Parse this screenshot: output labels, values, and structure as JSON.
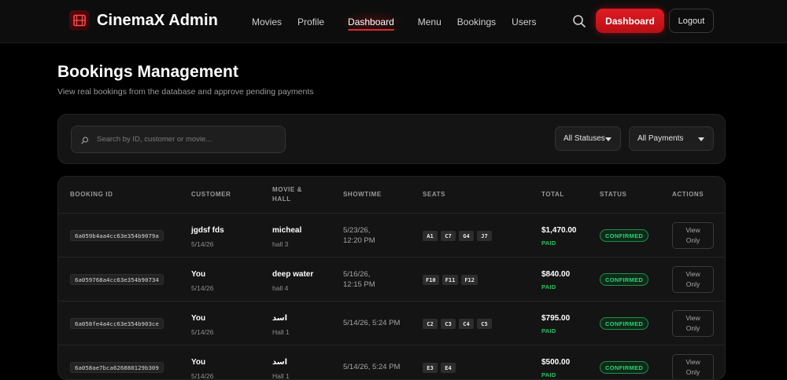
{
  "nav": {
    "brand": "CinemaX Admin",
    "links": [
      "Movies",
      "Profile",
      "Dashboard",
      "Menu",
      "Bookings",
      "Users"
    ],
    "active_link": "Dashboard",
    "dashboard_button": "Dashboard",
    "logout_button": "Logout"
  },
  "colors": {
    "accent": "#e01b22",
    "paid": "#22c55e",
    "confirmed": "#2fd072",
    "background": "#000000"
  },
  "header": {
    "title": "Bookings Management",
    "subtitle": "View real bookings from the database and approve pending payments"
  },
  "filters": {
    "search_placeholder": "Search by ID, customer or movie...",
    "status_selected": "All Statuses",
    "payment_selected": "All Payments"
  },
  "table": {
    "headers": {
      "booking_id": "BOOKING ID",
      "customer": "CUSTOMER",
      "movie_hall_1": "MOVIE &",
      "movie_hall_2": "HALL",
      "showtime": "SHOWTIME",
      "seats": "SEATS",
      "total": "TOTAL",
      "status": "STATUS",
      "actions": "ACTIONS"
    },
    "rows": [
      {
        "id": "6a059b4aa4cc63e354b9079a",
        "customer": "jgdsf fds",
        "customer_date": "5/14/26",
        "movie": "micheal",
        "hall": "hall 3",
        "showtime_1": "5/23/26,",
        "showtime_2": "12:20 PM",
        "seats": [
          "A1",
          "C7",
          "G4",
          "J7"
        ],
        "total": "$1,470.00",
        "payment": "PAID",
        "status": "CONFIRMED",
        "action_1": "View",
        "action_2": "Only"
      },
      {
        "id": "6a059768a4cc63e354b90734",
        "customer": "You",
        "customer_date": "5/14/26",
        "movie": "deep water",
        "hall": "hall 4",
        "showtime_1": "5/16/26,",
        "showtime_2": "12:15 PM",
        "seats": [
          "F10",
          "F11",
          "F12"
        ],
        "total": "$840.00",
        "payment": "PAID",
        "status": "CONFIRMED",
        "action_1": "View",
        "action_2": "Only"
      },
      {
        "id": "6a058fe4a4cc63e354b903ce",
        "customer": "You",
        "customer_date": "5/14/26",
        "movie": "اسد",
        "hall": "Hall 1",
        "showtime_1": "5/14/26, 5:24 PM",
        "showtime_2": "",
        "seats": [
          "C2",
          "C3",
          "C4",
          "C5"
        ],
        "total": "$795.00",
        "payment": "PAID",
        "status": "CONFIRMED",
        "action_1": "View",
        "action_2": "Only"
      },
      {
        "id": "6a058ae7bca626880129b309",
        "customer": "You",
        "customer_date": "5/14/26",
        "movie": "اسد",
        "hall": "Hall 1",
        "showtime_1": "5/14/26, 5:24 PM",
        "showtime_2": "",
        "seats": [
          "E3",
          "E4"
        ],
        "total": "$500.00",
        "payment": "PAID",
        "status": "CONFIRMED",
        "action_1": "View",
        "action_2": "Only"
      }
    ]
  }
}
